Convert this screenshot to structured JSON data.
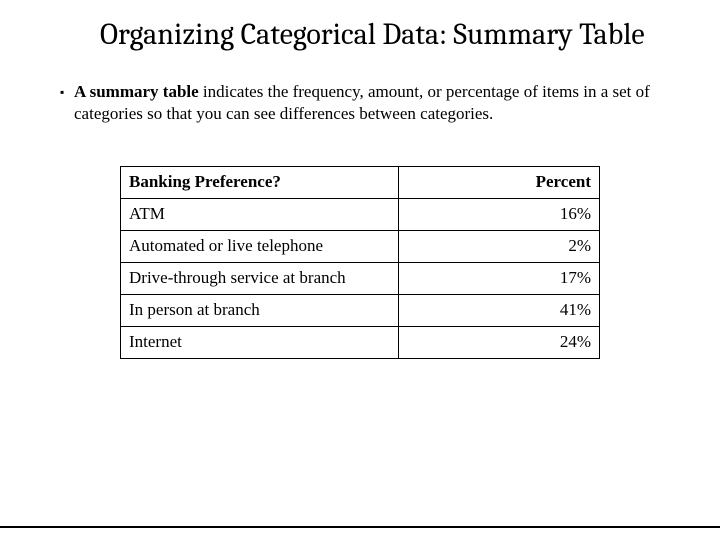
{
  "title": "Organizing Categorical Data: Summary Table",
  "bullet": {
    "bold_lead": "A summary table",
    "rest": " indicates the frequency, amount, or percentage of items in a set of categories so that you can see differences between categories."
  },
  "table": {
    "headers": {
      "left": "Banking Preference?",
      "right": "Percent"
    },
    "rows": [
      {
        "label": "ATM",
        "value": "16%"
      },
      {
        "label": "Automated or live telephone",
        "value": "2%"
      },
      {
        "label": "Drive-through service at branch",
        "value": "17%"
      },
      {
        "label": "In person at branch",
        "value": "41%"
      },
      {
        "label": "Internet",
        "value": "24%"
      }
    ]
  },
  "chart_data": {
    "type": "table",
    "title": "Banking Preference? — Percent",
    "categories": [
      "ATM",
      "Automated or live telephone",
      "Drive-through service at branch",
      "In person at branch",
      "Internet"
    ],
    "values": [
      16,
      2,
      17,
      41,
      24
    ],
    "xlabel": "Banking Preference?",
    "ylabel": "Percent",
    "ylim": [
      0,
      100
    ]
  }
}
